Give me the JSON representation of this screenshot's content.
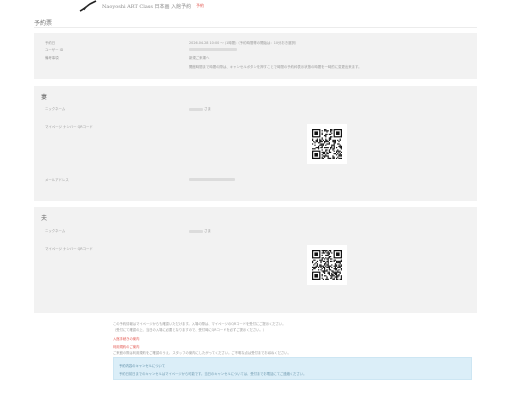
{
  "header": {
    "logo": "ink-brush-logo",
    "site_title": "Naoyoshi ART Class 日本画 入館予約",
    "nav_link": "予約"
  },
  "page": {
    "title": "予約票"
  },
  "reservation": {
    "rows": [
      {
        "label": "予約日",
        "value": "2026.04.28 10:00 〜 (1時間)（予約時間帯の開始は：10分おき選択）"
      },
      {
        "label": "ユーザー ID",
        "value": ""
      },
      {
        "label": "備考事項",
        "value": "新規ご来場へ"
      },
      {
        "label": "",
        "value": "開館時間まで時間の際は、キャンセルボタンを押すことで時間の予約枠表示状態の時間を一時的に変更出来ます。"
      }
    ]
  },
  "wife": {
    "heading": "妻",
    "name_label": "ニックネーム",
    "name_suffix": "さま",
    "qr_label": "マイページ ナンバー QRコード",
    "email_label": "メールアドレス"
  },
  "husband": {
    "heading": "夫",
    "name_label": "ニックネーム",
    "name_suffix": "さま",
    "qr_label": "マイページ ナンバー QRコード"
  },
  "notes": {
    "line1": "この予約情報はマイページからも確認いただけます。入場の際は、マイページのQRコードを受付にご提示ください。",
    "line2": "（受付にて確認の上、当日の入場に必要となりますので、受付時にQRコードを必ずご提示ください。）",
    "link1": "入館手続きの案内",
    "link2": "利用規約のご案内",
    "line3": "ご来館の際は利用規約をご確認のうえ、スタッフの案内にしたがってください。ご不明な点は受付までお尋ねください。"
  },
  "info": {
    "title": "予約内容のキャンセルについて",
    "body": "予約日前日までのキャンセルはマイページから可能です。当日のキャンセルについては、受付までお電話にてご連絡ください。"
  },
  "colors": {
    "accent": "#e2554e",
    "panel": "#f2f2f2",
    "info_bg": "#dbeef8"
  }
}
